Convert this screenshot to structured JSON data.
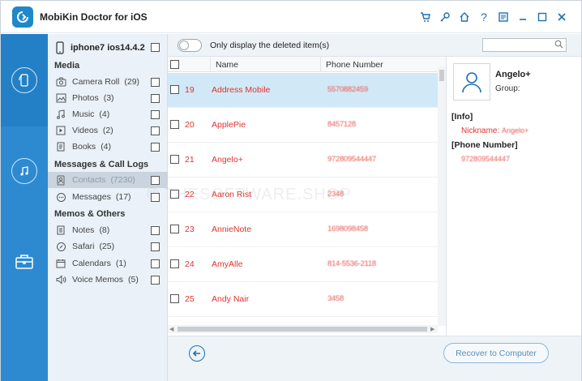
{
  "app": {
    "title": "MobiKin Doctor for iOS",
    "title_icons": [
      "cart-icon",
      "key-icon",
      "home-icon",
      "help-icon",
      "feedback-icon",
      "minimize-icon",
      "maximize-icon",
      "close-icon"
    ]
  },
  "rail": {
    "items": [
      {
        "icon": "phone-recovery-icon",
        "active": true
      },
      {
        "icon": "itunes-backup-icon",
        "active": false
      },
      {
        "icon": "toolbox-icon",
        "active": false
      }
    ]
  },
  "device": {
    "name": "iphone7 ios14.4.2"
  },
  "sections": {
    "media": {
      "title": "Media"
    },
    "messages": {
      "title": "Messages & Call Logs"
    },
    "memos": {
      "title": "Memos & Others"
    }
  },
  "categories": [
    {
      "label": "Camera Roll",
      "count": "(29)",
      "icon": "camera-icon"
    },
    {
      "label": "Photos",
      "count": "(3)",
      "icon": "photo-icon"
    },
    {
      "label": "Music",
      "count": "(4)",
      "icon": "music-icon"
    },
    {
      "label": "Videos",
      "count": "(2)",
      "icon": "video-icon"
    },
    {
      "label": "Books",
      "count": "(4)",
      "icon": "book-icon"
    },
    {
      "label": "Contacts",
      "count": "(7230)",
      "icon": "contacts-icon",
      "selected": true
    },
    {
      "label": "Messages",
      "count": "(17)",
      "icon": "message-icon"
    },
    {
      "label": "Notes",
      "count": "(8)",
      "icon": "notes-icon"
    },
    {
      "label": "Safari",
      "count": "(25)",
      "icon": "safari-icon"
    },
    {
      "label": "Calendars",
      "count": "(1)",
      "icon": "calendar-icon"
    },
    {
      "label": "Voice Memos",
      "count": "(5)",
      "icon": "voice-memo-icon"
    }
  ],
  "toolbar": {
    "toggle_label": "Only display the deleted item(s)",
    "search_placeholder": ""
  },
  "table": {
    "columns": {
      "name": "Name",
      "phone": "Phone Number"
    },
    "rows": [
      {
        "idx": "19",
        "name": "Address Mobile",
        "phone": "5570882459"
      },
      {
        "idx": "20",
        "name": "ApplePie",
        "phone": "8457128"
      },
      {
        "idx": "21",
        "name": "Angelo+",
        "phone": "972809544447"
      },
      {
        "idx": "22",
        "name": "Aaron Rist",
        "phone": "2348"
      },
      {
        "idx": "23",
        "name": "AnnieNote",
        "phone": "1698098458"
      },
      {
        "idx": "24",
        "name": "AmyAlle",
        "phone": "814-5536-2118"
      },
      {
        "idx": "25",
        "name": "Andy Nair",
        "phone": "3458"
      }
    ]
  },
  "detail": {
    "name": "Angelo+",
    "group_label": "Group:",
    "info_title": "[Info]",
    "nickname_label": "Nickname:",
    "nickname_value": "Angelo+",
    "phone_title": "[Phone Number]",
    "phone_value": "972809544447"
  },
  "bottom": {
    "recover_label": "Recover to Computer"
  },
  "watermark": "© THESOFTWARE.SHOP",
  "colors": {
    "brand": "#2d8ad1",
    "accent_red": "#e0332f",
    "selection": "#d1e9f6"
  }
}
